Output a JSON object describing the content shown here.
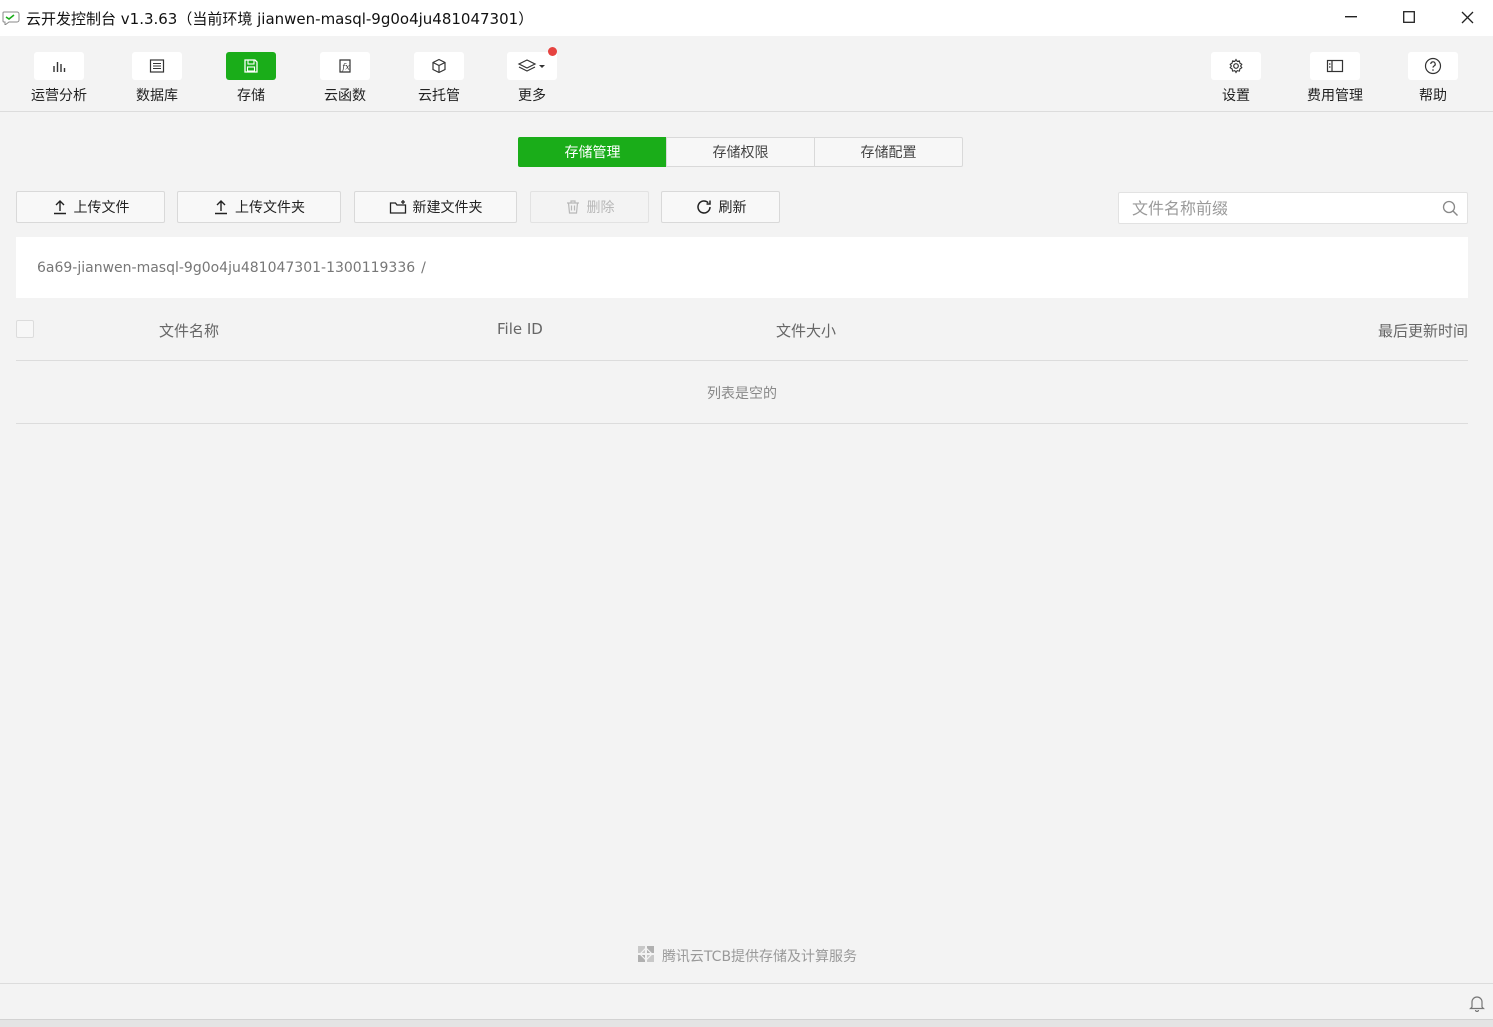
{
  "window": {
    "title": "云开发控制台 v1.3.63（当前环境 jianwen-masql-9g0o4ju481047301）"
  },
  "toolbar": {
    "left": [
      {
        "label": "运营分析",
        "icon": "bar-chart-icon"
      },
      {
        "label": "数据库",
        "icon": "database-icon"
      },
      {
        "label": "存储",
        "icon": "storage-icon"
      },
      {
        "label": "云函数",
        "icon": "function-icon"
      },
      {
        "label": "云托管",
        "icon": "cube-icon"
      },
      {
        "label": "更多",
        "icon": "layers-icon"
      }
    ],
    "right": [
      {
        "label": "设置",
        "icon": "gear-icon"
      },
      {
        "label": "费用管理",
        "icon": "billing-icon"
      },
      {
        "label": "帮助",
        "icon": "help-icon"
      }
    ],
    "active": "存储"
  },
  "tabs": [
    {
      "label": "存储管理",
      "active": true
    },
    {
      "label": "存储权限",
      "active": false
    },
    {
      "label": "存储配置",
      "active": false
    }
  ],
  "actions": {
    "upload_file": "上传文件",
    "upload_folder": "上传文件夹",
    "new_folder": "新建文件夹",
    "delete": "删除",
    "refresh": "刷新"
  },
  "search": {
    "placeholder": "文件名称前缀",
    "value": ""
  },
  "breadcrumb": {
    "bucket": "6a69-jianwen-masql-9g0o4ju481047301-1300119336",
    "separator": "/"
  },
  "table": {
    "columns": [
      "文件名称",
      "File ID",
      "文件大小",
      "最后更新时间"
    ],
    "empty_text": "列表是空的"
  },
  "footer": {
    "note": "腾讯云TCB提供存储及计算服务"
  },
  "colors": {
    "accent": "#1aad19",
    "notification_dot": "#e64340"
  }
}
